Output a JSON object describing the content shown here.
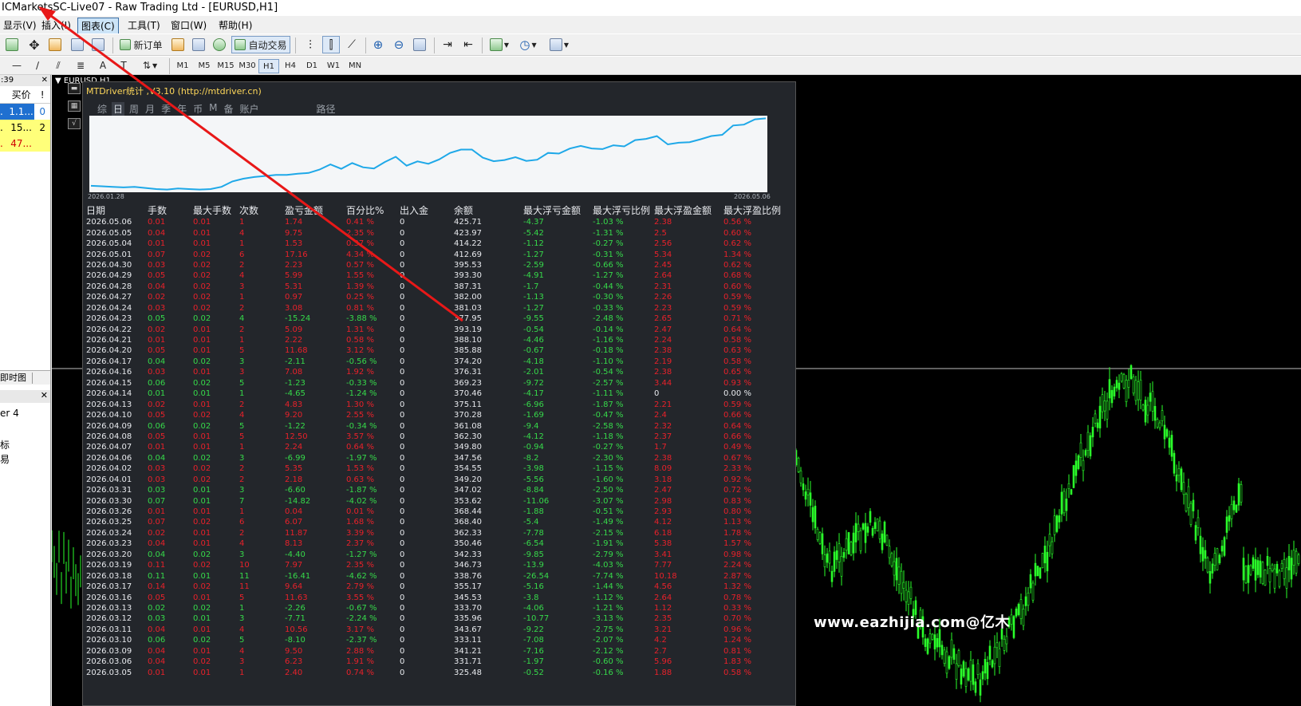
{
  "window": {
    "title": "ICMarketsSC-Live07 - Raw Trading Ltd - [EURUSD,H1]"
  },
  "menu": [
    {
      "label": "显示(V)"
    },
    {
      "label": "插入(I)"
    },
    {
      "label": "图表(C)"
    },
    {
      "label": "工具(T)"
    },
    {
      "label": "窗口(W)"
    },
    {
      "label": "帮助(H)"
    }
  ],
  "toolbar": {
    "new_order_label": "新订单",
    "auto_trade_label": "自动交易"
  },
  "timeframes": [
    "M1",
    "M5",
    "M15",
    "M30",
    "H1",
    "H4",
    "D1",
    "W1",
    "MN"
  ],
  "selected_timeframe": "H1",
  "market_watch": {
    "time": ":39",
    "col_bid": "买价",
    "col_flag": "!",
    "rows": [
      {
        "a": ".",
        "bid": "1.1...",
        "flag": "0",
        "bg": "#1f70d0",
        "fg": "#ffffff"
      },
      {
        "a": ".",
        "bid": "15...",
        "flag": "2",
        "bg": "#ffff7a",
        "fg": "#000000"
      },
      {
        "a": ".",
        "bid": "47...",
        "flag": "",
        "bg": "#ffff7a",
        "fg": "#d00000"
      }
    ],
    "tab_label": "即时图"
  },
  "navigator": {
    "line1": "er 4",
    "line2": "标",
    "line3": "易"
  },
  "chart": {
    "title": "EURUSD,H1"
  },
  "watermark": "www.eazhijia.com@亿木",
  "mtdriver": {
    "title": "MTDriver统计 ,V3.10 (http://mtdriver.cn)",
    "tabs": [
      "综",
      "日",
      "周",
      "月",
      "季",
      "年",
      "币",
      "M",
      "备",
      "账户",
      "路径"
    ],
    "active_tab": "日",
    "equity_start": "2026.01.28",
    "equity_end": "2026.05.06",
    "headers": [
      "日期",
      "手数",
      "最大手数",
      "次数",
      "盈亏金额",
      "百分比%",
      "出入金",
      "余额",
      "最大浮亏金额",
      "最大浮亏比例",
      "最大浮盈金额",
      "最大浮盈比例"
    ],
    "rows": [
      [
        "2026.05.06",
        "0.01",
        "0.01",
        "1",
        "1.74",
        "0.41 %",
        "0",
        "425.71",
        "-4.37",
        "-1.03 %",
        "2.38",
        "0.56 %"
      ],
      [
        "2026.05.05",
        "0.04",
        "0.01",
        "4",
        "9.75",
        "2.35 %",
        "0",
        "423.97",
        "-5.42",
        "-1.31 %",
        "2.5",
        "0.60 %"
      ],
      [
        "2026.05.04",
        "0.01",
        "0.01",
        "1",
        "1.53",
        "0.37 %",
        "0",
        "414.22",
        "-1.12",
        "-0.27 %",
        "2.56",
        "0.62 %"
      ],
      [
        "2026.05.01",
        "0.07",
        "0.02",
        "6",
        "17.16",
        "4.34 %",
        "0",
        "412.69",
        "-1.27",
        "-0.31 %",
        "5.34",
        "1.34 %"
      ],
      [
        "2026.04.30",
        "0.03",
        "0.02",
        "2",
        "2.23",
        "0.57 %",
        "0",
        "395.53",
        "-2.59",
        "-0.66 %",
        "2.45",
        "0.62 %"
      ],
      [
        "2026.04.29",
        "0.05",
        "0.02",
        "4",
        "5.99",
        "1.55 %",
        "0",
        "393.30",
        "-4.91",
        "-1.27 %",
        "2.64",
        "0.68 %"
      ],
      [
        "2026.04.28",
        "0.04",
        "0.02",
        "3",
        "5.31",
        "1.39 %",
        "0",
        "387.31",
        "-1.7",
        "-0.44 %",
        "2.31",
        "0.60 %"
      ],
      [
        "2026.04.27",
        "0.02",
        "0.02",
        "1",
        "0.97",
        "0.25 %",
        "0",
        "382.00",
        "-1.13",
        "-0.30 %",
        "2.26",
        "0.59 %"
      ],
      [
        "2026.04.24",
        "0.03",
        "0.02",
        "2",
        "3.08",
        "0.81 %",
        "0",
        "381.03",
        "-1.27",
        "-0.33 %",
        "2.23",
        "0.59 %"
      ],
      [
        "2026.04.23",
        "0.05",
        "0.02",
        "4",
        "-15.24",
        "-3.88 %",
        "0",
        "377.95",
        "-9.55",
        "-2.48 %",
        "2.65",
        "0.71 %"
      ],
      [
        "2026.04.22",
        "0.02",
        "0.01",
        "2",
        "5.09",
        "1.31 %",
        "0",
        "393.19",
        "-0.54",
        "-0.14 %",
        "2.47",
        "0.64 %"
      ],
      [
        "2026.04.21",
        "0.01",
        "0.01",
        "1",
        "2.22",
        "0.58 %",
        "0",
        "388.10",
        "-4.46",
        "-1.16 %",
        "2.24",
        "0.58 %"
      ],
      [
        "2026.04.20",
        "0.05",
        "0.01",
        "5",
        "11.68",
        "3.12 %",
        "0",
        "385.88",
        "-0.67",
        "-0.18 %",
        "2.38",
        "0.63 %"
      ],
      [
        "2026.04.17",
        "0.04",
        "0.02",
        "3",
        "-2.11",
        "-0.56 %",
        "0",
        "374.20",
        "-4.18",
        "-1.10 %",
        "2.19",
        "0.58 %"
      ],
      [
        "2026.04.16",
        "0.03",
        "0.01",
        "3",
        "7.08",
        "1.92 %",
        "0",
        "376.31",
        "-2.01",
        "-0.54 %",
        "2.38",
        "0.65 %"
      ],
      [
        "2026.04.15",
        "0.06",
        "0.02",
        "5",
        "-1.23",
        "-0.33 %",
        "0",
        "369.23",
        "-9.72",
        "-2.57 %",
        "3.44",
        "0.93 %"
      ],
      [
        "2026.04.14",
        "0.01",
        "0.01",
        "1",
        "-4.65",
        "-1.24 %",
        "0",
        "370.46",
        "-4.17",
        "-1.11 %",
        "0",
        "0.00 %"
      ],
      [
        "2026.04.13",
        "0.02",
        "0.01",
        "2",
        "4.83",
        "1.30 %",
        "0",
        "375.11",
        "-6.96",
        "-1.87 %",
        "2.21",
        "0.59 %"
      ],
      [
        "2026.04.10",
        "0.05",
        "0.02",
        "4",
        "9.20",
        "2.55 %",
        "0",
        "370.28",
        "-1.69",
        "-0.47 %",
        "2.4",
        "0.66 %"
      ],
      [
        "2026.04.09",
        "0.06",
        "0.02",
        "5",
        "-1.22",
        "-0.34 %",
        "0",
        "361.08",
        "-9.4",
        "-2.58 %",
        "2.32",
        "0.64 %"
      ],
      [
        "2026.04.08",
        "0.05",
        "0.01",
        "5",
        "12.50",
        "3.57 %",
        "0",
        "362.30",
        "-4.12",
        "-1.18 %",
        "2.37",
        "0.66 %"
      ],
      [
        "2026.04.07",
        "0.01",
        "0.01",
        "1",
        "2.24",
        "0.64 %",
        "0",
        "349.80",
        "-0.94",
        "-0.27 %",
        "1.7",
        "0.49 %"
      ],
      [
        "2026.04.06",
        "0.04",
        "0.02",
        "3",
        "-6.99",
        "-1.97 %",
        "0",
        "347.56",
        "-8.2",
        "-2.30 %",
        "2.38",
        "0.67 %"
      ],
      [
        "2026.04.02",
        "0.03",
        "0.02",
        "2",
        "5.35",
        "1.53 %",
        "0",
        "354.55",
        "-3.98",
        "-1.15 %",
        "8.09",
        "2.33 %"
      ],
      [
        "2026.04.01",
        "0.03",
        "0.02",
        "2",
        "2.18",
        "0.63 %",
        "0",
        "349.20",
        "-5.56",
        "-1.60 %",
        "3.18",
        "0.92 %"
      ],
      [
        "2026.03.31",
        "0.03",
        "0.01",
        "3",
        "-6.60",
        "-1.87 %",
        "0",
        "347.02",
        "-8.84",
        "-2.50 %",
        "2.47",
        "0.72 %"
      ],
      [
        "2026.03.30",
        "0.07",
        "0.01",
        "7",
        "-14.82",
        "-4.02 %",
        "0",
        "353.62",
        "-11.06",
        "-3.07 %",
        "2.98",
        "0.83 %"
      ],
      [
        "2026.03.26",
        "0.01",
        "0.01",
        "1",
        "0.04",
        "0.01 %",
        "0",
        "368.44",
        "-1.88",
        "-0.51 %",
        "2.93",
        "0.80 %"
      ],
      [
        "2026.03.25",
        "0.07",
        "0.02",
        "6",
        "6.07",
        "1.68 %",
        "0",
        "368.40",
        "-5.4",
        "-1.49 %",
        "4.12",
        "1.13 %"
      ],
      [
        "2026.03.24",
        "0.02",
        "0.01",
        "2",
        "11.87",
        "3.39 %",
        "0",
        "362.33",
        "-7.78",
        "-2.15 %",
        "6.18",
        "1.78 %"
      ],
      [
        "2026.03.23",
        "0.04",
        "0.01",
        "4",
        "8.13",
        "2.37 %",
        "0",
        "350.46",
        "-6.54",
        "-1.91 %",
        "5.38",
        "1.57 %"
      ],
      [
        "2026.03.20",
        "0.04",
        "0.02",
        "3",
        "-4.40",
        "-1.27 %",
        "0",
        "342.33",
        "-9.85",
        "-2.79 %",
        "3.41",
        "0.98 %"
      ],
      [
        "2026.03.19",
        "0.11",
        "0.02",
        "10",
        "7.97",
        "2.35 %",
        "0",
        "346.73",
        "-13.9",
        "-4.03 %",
        "7.77",
        "2.24 %"
      ],
      [
        "2026.03.18",
        "0.11",
        "0.01",
        "11",
        "-16.41",
        "-4.62 %",
        "0",
        "338.76",
        "-26.54",
        "-7.74 %",
        "10.18",
        "2.87 %"
      ],
      [
        "2026.03.17",
        "0.14",
        "0.02",
        "11",
        "9.64",
        "2.79 %",
        "0",
        "355.17",
        "-5.16",
        "-1.44 %",
        "4.56",
        "1.32 %"
      ],
      [
        "2026.03.16",
        "0.05",
        "0.01",
        "5",
        "11.63",
        "3.55 %",
        "0",
        "345.53",
        "-3.8",
        "-1.12 %",
        "2.64",
        "0.78 %"
      ],
      [
        "2026.03.13",
        "0.02",
        "0.02",
        "1",
        "-2.26",
        "-0.67 %",
        "0",
        "333.70",
        "-4.06",
        "-1.21 %",
        "1.12",
        "0.33 %"
      ],
      [
        "2026.03.12",
        "0.03",
        "0.01",
        "3",
        "-7.71",
        "-2.24 %",
        "0",
        "335.96",
        "-10.77",
        "-3.13 %",
        "2.35",
        "0.70 %"
      ],
      [
        "2026.03.11",
        "0.04",
        "0.01",
        "4",
        "10.56",
        "3.17 %",
        "0",
        "343.67",
        "-9.22",
        "-2.75 %",
        "3.21",
        "0.96 %"
      ],
      [
        "2026.03.10",
        "0.06",
        "0.02",
        "5",
        "-8.10",
        "-2.37 %",
        "0",
        "333.11",
        "-7.08",
        "-2.07 %",
        "4.2",
        "1.24 %"
      ],
      [
        "2026.03.09",
        "0.04",
        "0.01",
        "4",
        "9.50",
        "2.88 %",
        "0",
        "341.21",
        "-7.16",
        "-2.12 %",
        "2.7",
        "0.81 %"
      ],
      [
        "2026.03.06",
        "0.04",
        "0.02",
        "3",
        "6.23",
        "1.91 %",
        "0",
        "331.71",
        "-1.97",
        "-0.60 %",
        "5.96",
        "1.83 %"
      ],
      [
        "2026.03.05",
        "0.01",
        "0.01",
        "1",
        "2.40",
        "0.74 %",
        "0",
        "325.48",
        "-0.52",
        "-0.16 %",
        "1.88",
        "0.58 %"
      ]
    ]
  },
  "colors": {
    "profit": "#e8212a",
    "loss": "#36d94a",
    "candles": "#2aff2a",
    "equity_line": "#1ea8e8",
    "arrow": "#e81818"
  }
}
